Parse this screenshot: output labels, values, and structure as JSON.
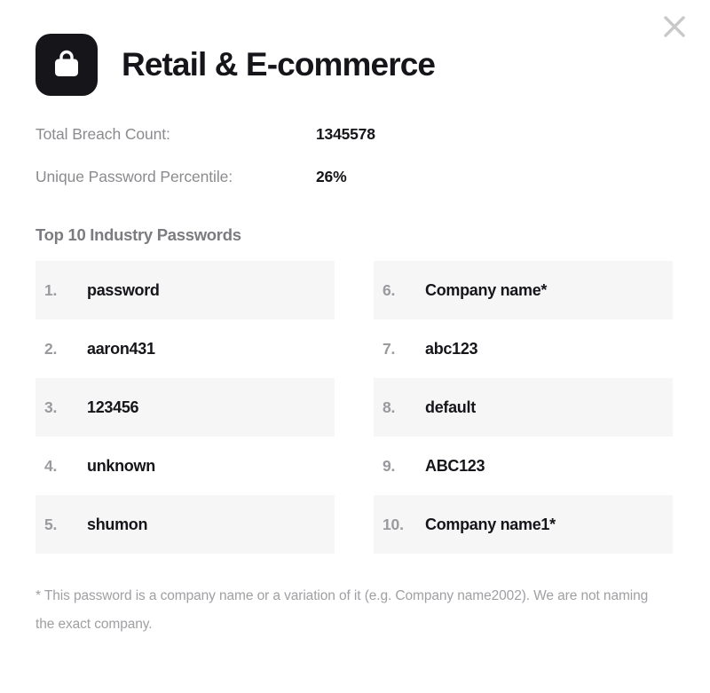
{
  "close_button": {
    "icon": "close-icon",
    "label": "×"
  },
  "header": {
    "icon": "shopping-bag-icon",
    "title": "Retail & E-commerce"
  },
  "stats": [
    {
      "label": "Total Breach Count:",
      "value": "1345578"
    },
    {
      "label": "Unique Password Percentile:",
      "value": "26%"
    }
  ],
  "passwords_section": {
    "heading": "Top 10 Industry Passwords",
    "left_column": [
      {
        "rank": "1.",
        "password": "password"
      },
      {
        "rank": "2.",
        "password": "aaron431"
      },
      {
        "rank": "3.",
        "password": "123456"
      },
      {
        "rank": "4.",
        "password": "unknown"
      },
      {
        "rank": "5.",
        "password": "shumon"
      }
    ],
    "right_column": [
      {
        "rank": "6.",
        "password": "Company name*"
      },
      {
        "rank": "7.",
        "password": "abc123"
      },
      {
        "rank": "8.",
        "password": "default"
      },
      {
        "rank": "9.",
        "password": "ABC123"
      },
      {
        "rank": "10.",
        "password": "Company name1*"
      }
    ]
  },
  "footnote": "* This password is a company name or a variation of it (e.g. Company name2002). We are not naming the exact company.",
  "colors": {
    "brand_dark": "#15151a",
    "row_shade": "#f6f6f6",
    "muted_text": "#8b8b8f",
    "heading_gray": "#7c7c80"
  }
}
